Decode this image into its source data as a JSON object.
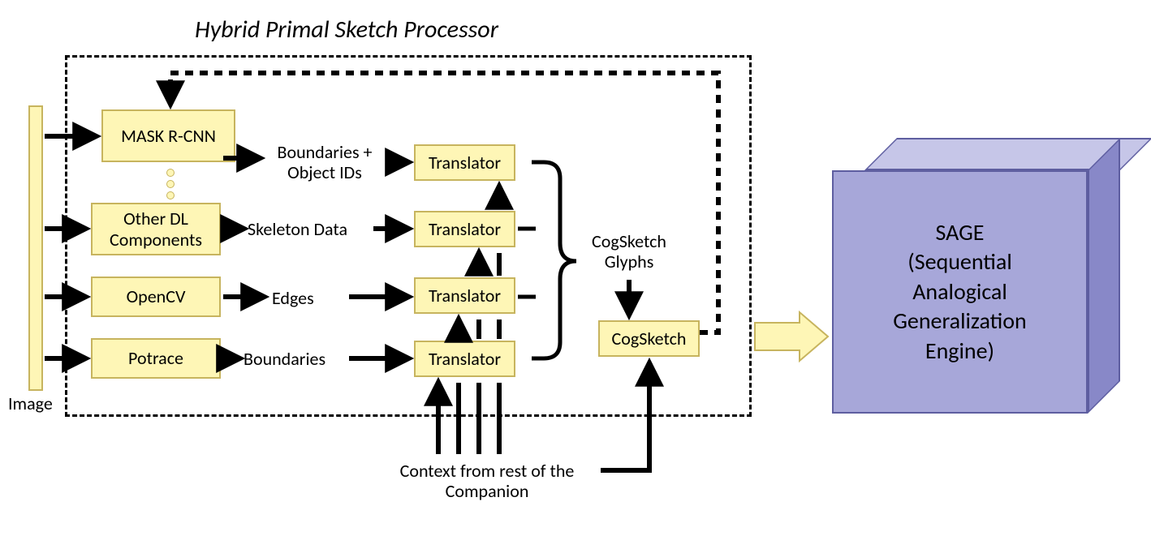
{
  "title": "Hybrid Primal Sketch Processor",
  "nodes": {
    "mask_rcnn": "MASK R-CNN",
    "other_dl": "Other DL\nComponents",
    "opencv": "OpenCV",
    "potrace": "Potrace",
    "translator1": "Translator",
    "translator2": "Translator",
    "translator3": "Translator",
    "translator4": "Translator",
    "cogsketch": "CogSketch"
  },
  "labels": {
    "boundaries_ids": "Boundaries +\nObject IDs",
    "skeleton": "Skeleton Data",
    "edges": "Edges",
    "boundaries": "Boundaries",
    "image": "Image",
    "cogsketch_glyphs": "CogSketch\nGlyphs",
    "context": "Context from rest of the\nCompanion"
  },
  "sage": "SAGE\n(Sequential\nAnalogical\nGeneralization\nEngine)"
}
